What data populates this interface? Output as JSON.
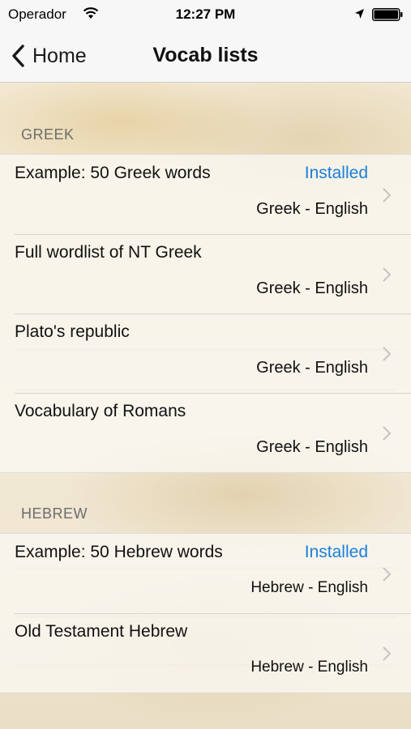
{
  "status_bar": {
    "carrier": "Operador",
    "time": "12:27 PM"
  },
  "nav": {
    "back_label": "Home",
    "title": "Vocab lists"
  },
  "sections": [
    {
      "header": "GREEK",
      "items": [
        {
          "title": "Example: 50 Greek words",
          "status": "Installed",
          "language": "Greek - English"
        },
        {
          "title": "Full wordlist of NT Greek",
          "status": "",
          "language": "Greek - English"
        },
        {
          "title": "Plato's republic",
          "status": "",
          "language": "Greek - English"
        },
        {
          "title": "Vocabulary of Romans",
          "status": "",
          "language": "Greek - English"
        }
      ]
    },
    {
      "header": "HEBREW",
      "items": [
        {
          "title": "Example: 50 Hebrew words",
          "status": "Installed",
          "language": "Hebrew - English"
        },
        {
          "title": "Old Testament Hebrew",
          "status": "",
          "language": "Hebrew - English"
        }
      ]
    }
  ],
  "colors": {
    "accent": "#1a7fd8",
    "bar_background": "#f7f7f7",
    "section_header": "#6d6d6d"
  },
  "icons": [
    "wifi-icon",
    "location-icon",
    "battery-icon",
    "back-chevron-icon",
    "chevron-icon"
  ]
}
